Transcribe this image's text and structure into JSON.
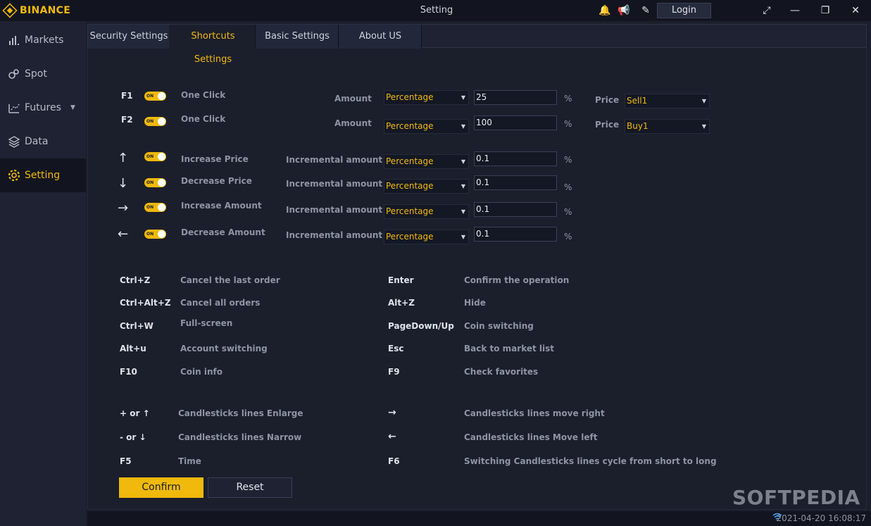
{
  "app": {
    "brand": "BINANCE",
    "window_title": "Setting",
    "login_label": "Login"
  },
  "sidebar": {
    "items": [
      {
        "label": "Markets",
        "icon": "bar-chart-icon"
      },
      {
        "label": "Spot",
        "icon": "spot-icon"
      },
      {
        "label": "Futures",
        "icon": "futures-icon"
      },
      {
        "label": "Data",
        "icon": "layers-icon"
      },
      {
        "label": "Setting",
        "icon": "gear-icon"
      }
    ]
  },
  "tabs": [
    "Security Settings",
    "Shortcuts Settings",
    "Basic Settings",
    "About US"
  ],
  "one_click": [
    {
      "key": "F1",
      "label": "One Click",
      "amount_label": "Amount",
      "mode": "Percentage",
      "value": "25",
      "unit": "%",
      "price_label": "Price",
      "price": "Sell1"
    },
    {
      "key": "F2",
      "label": "One Click",
      "amount_label": "Amount",
      "mode": "Percentage",
      "value": "100",
      "unit": "%",
      "price_label": "Price",
      "price": "Buy1"
    }
  ],
  "toggle_text": "ON",
  "increments": [
    {
      "arrow": "↑",
      "label": "Increase Price",
      "inc_label": "Incremental amount",
      "mode": "Percentage",
      "value": "0.1",
      "unit": "%"
    },
    {
      "arrow": "↓",
      "label": "Decrease Price",
      "inc_label": "Incremental amount",
      "mode": "Percentage",
      "value": "0.1",
      "unit": "%"
    },
    {
      "arrow": "→",
      "label": "Increase Amount",
      "inc_label": "Incremental amount",
      "mode": "Percentage",
      "value": "0.1",
      "unit": "%"
    },
    {
      "arrow": "←",
      "label": "Decrease Amount",
      "inc_label": "Incremental amount",
      "mode": "Percentage",
      "value": "0.1",
      "unit": "%"
    }
  ],
  "shortcuts_left": [
    {
      "key": "Ctrl+Z",
      "desc": "Cancel the last order"
    },
    {
      "key": "Ctrl+Alt+Z",
      "desc": "Cancel all orders"
    },
    {
      "key": "Ctrl+W",
      "desc": "Full-screen"
    },
    {
      "key": "Alt+u",
      "desc": "Account switching"
    },
    {
      "key": "F10",
      "desc": "Coin info"
    }
  ],
  "shortcuts_right": [
    {
      "key": "Enter",
      "desc": "Confirm the operation"
    },
    {
      "key": "Alt+Z",
      "desc": "Hide"
    },
    {
      "key": "PageDown/Up",
      "desc": "Coin switching"
    },
    {
      "key": "Esc",
      "desc": "Back to market list"
    },
    {
      "key": "F9",
      "desc": "Check favorites"
    }
  ],
  "candles_left": [
    {
      "key": "+ or ↑",
      "desc": "Candlesticks lines Enlarge"
    },
    {
      "key": "- or ↓",
      "desc": "Candlesticks lines Narrow"
    },
    {
      "key": "F5",
      "desc": "Time"
    }
  ],
  "candles_right": [
    {
      "key": "→",
      "desc": "Candlesticks lines move right"
    },
    {
      "key": "←",
      "desc": "Candlesticks lines Move left"
    },
    {
      "key": "F6",
      "desc": "Switching Candlesticks lines cycle from short to long"
    }
  ],
  "buttons": {
    "confirm": "Confirm",
    "reset": "Reset"
  },
  "status": {
    "time": "2021-04-20 16:08:17"
  },
  "watermark": "SOFTPEDIA",
  "colors": {
    "accent": "#f0b90b",
    "bg": "#1b1f2c",
    "sidebar": "#1e2232"
  }
}
